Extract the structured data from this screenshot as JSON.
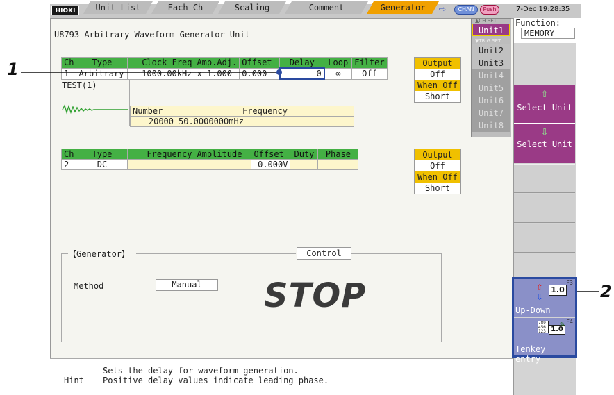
{
  "topbar": {
    "logo": "HIOKI",
    "tabs": [
      "Unit List",
      "Each Ch",
      "Scaling",
      "Comment",
      "Generator"
    ],
    "chan_label": "CHAN",
    "push_label": "Push",
    "datetime": "7-Dec 19:28:35"
  },
  "function": {
    "label": "Function:",
    "value": "MEMORY"
  },
  "main": {
    "unit_title": "U8793  Arbitrary Waveform Generator Unit",
    "ch1": {
      "headers": [
        "Ch",
        "Type",
        "Clock Freq",
        "Amp.Adj.",
        "Offset",
        "Delay",
        "Loop",
        "Filter"
      ],
      "values": [
        "1",
        "Arbitrary",
        "1000.00kHz",
        "x 1.000",
        "0.000",
        "0",
        "∞",
        "Off"
      ],
      "file": "TEST(1)",
      "number_label": "Number",
      "frequency_label": "Frequency",
      "number_value": "20000",
      "frequency_value": "50.0000000mHz"
    },
    "ch2": {
      "headers": [
        "Ch",
        "Type",
        "Frequency",
        "Amplitude",
        "Offset",
        "Duty",
        "Phase"
      ],
      "values": [
        "2",
        "DC",
        "",
        "",
        "0.000V",
        "",
        ""
      ]
    },
    "output1": {
      "output_label": "Output",
      "output_value": "Off",
      "whenoff_label": "When Off",
      "whenoff_value": "Short"
    },
    "output2": {
      "output_label": "Output",
      "output_value": "Off",
      "whenoff_label": "When Off",
      "whenoff_value": "Short"
    },
    "generator": {
      "section_label": "【Generator】",
      "control_label": "Control",
      "method_label": "Method",
      "method_value": "Manual",
      "status": "STOP"
    }
  },
  "hint": {
    "label": "Hint",
    "line1": "Sets the delay for waveform generation.",
    "line2": "Positive delay values indicate leading phase."
  },
  "units": {
    "items": [
      "Unit1",
      "Unit2",
      "Unit3",
      "Unit4",
      "Unit5",
      "Unit6",
      "Unit7",
      "Unit8"
    ],
    "top_tag": "▲CH SET",
    "trig_tag": "▼TRIG SET"
  },
  "sidebar": {
    "select_up": "Select Unit",
    "select_down": "Select Unit",
    "updown_label": "Up-Down",
    "updown_key": "F3",
    "tenkey_label": "Tenkey entry",
    "tenkey_key": "F4",
    "value_icon_text": "1.0"
  },
  "callouts": {
    "one": "1",
    "two": "2"
  }
}
